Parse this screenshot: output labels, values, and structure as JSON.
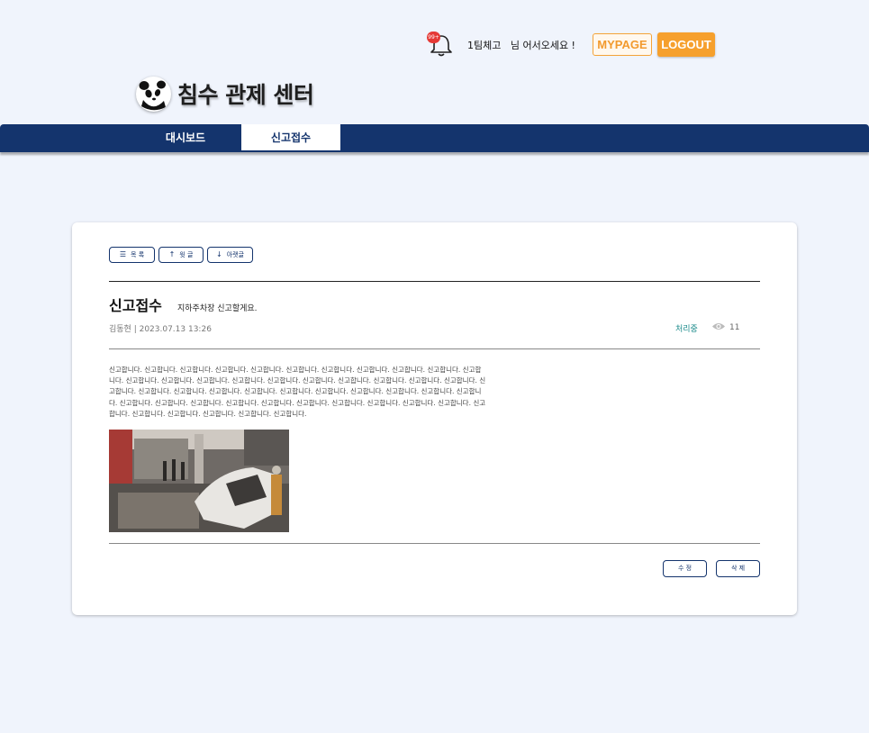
{
  "header": {
    "notification_count": "99+",
    "greeting": "1팀체고   님 어서오세요 !",
    "mypage_label": "MYPAGE",
    "logout_label": "LOGOUT",
    "site_title": "침수 관제 센터"
  },
  "nav": {
    "tabs": [
      {
        "label": "대시보드"
      },
      {
        "label": "신고접수"
      }
    ]
  },
  "post": {
    "buttons": {
      "list": "목 록",
      "prev": "윗 글",
      "next": "아랫글"
    },
    "category": "신고접수",
    "subject": "지하주차장 신고할게요.",
    "meta": "김동현 | 2023.07.13 13:26",
    "status": "처리중",
    "views": "11",
    "body": "신고합니다. 신고합니다. 신고합니다. 신고합니다. 신고합니다. 신고합니다. 신고합니다. 신고합니다. 신고합니다. 신고합니다. 신고합니다. 신고합니다. 신고합니다. 신고합니다. 신고합니다. 신고합니다. 신고합니다. 신고합니다. 신고합니다. 신고합니다. 신고합니다. 신고합니다. 신고합니다. 신고합니다. 신고합니다. 신고합니다. 신고합니다. 신고합니다. 신고합니다. 신고합니다. 신고합니다. 신고합니다. 신고합니다. 신고합니다. 신고합니다. 신고합니다. 신고합니다. 신고합니다. 신고합니다. 신고합니다. 신고합니다. 신고합니다. 신고합니다. 신고합니다. 신고합니다. 신고합니다. 신고합니다. 신고합니다.",
    "edit_label": "수 정",
    "delete_label": "삭 제"
  },
  "colors": {
    "nav_bg": "#14346d",
    "accent_orange": "#f6a02d",
    "page_bg": "#f0f4fc",
    "status_teal": "#1a8a8a"
  }
}
